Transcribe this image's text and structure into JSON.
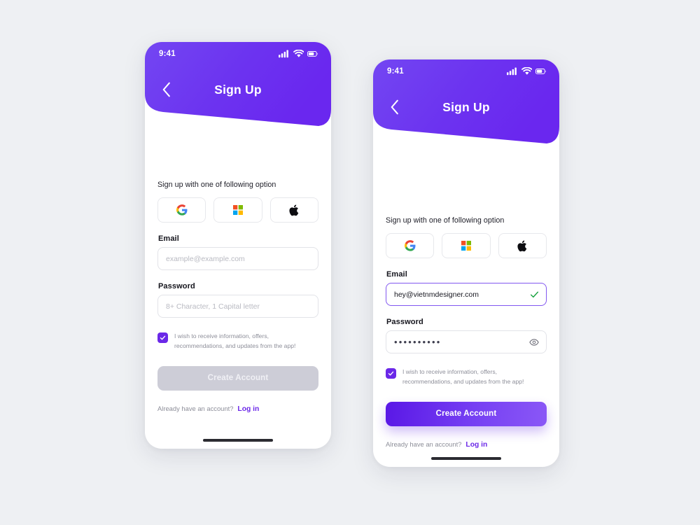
{
  "meta": {
    "background_color": "#eef0f3",
    "brand_purple": "#6b28e8",
    "brand_purple_light": "#8a57f6"
  },
  "status_bar": {
    "time": "9:41",
    "signal_icon": "cellular-signal-icon",
    "wifi_icon": "wifi-icon",
    "battery_icon": "battery-icon"
  },
  "header": {
    "title": "Sign Up",
    "back_icon": "chevron-left-icon"
  },
  "form": {
    "social_prompt": "Sign up with one of following option",
    "social_buttons": [
      {
        "name": "google",
        "icon": "google-icon"
      },
      {
        "name": "microsoft",
        "icon": "microsoft-icon"
      },
      {
        "name": "apple",
        "icon": "apple-icon"
      }
    ],
    "email_label": "Email",
    "password_label": "Password",
    "consent_text": "I wish to receive information, offers, recommendations, and updates from the app!",
    "footer_text": "Already have an account?",
    "footer_link": "Log in"
  },
  "screen_empty": {
    "email_value": "",
    "email_placeholder": "example@example.com",
    "password_value": "",
    "password_placeholder": "8+ Character, 1 Capital letter",
    "cta_label": "Create Account",
    "cta_state": "disabled"
  },
  "screen_filled": {
    "email_value": "hey@vietnmdesigner.com",
    "email_placeholder": "example@example.com",
    "password_masked": "••••••••••",
    "password_char_count": 10,
    "valid_icon": "check-mark-icon",
    "reveal_icon": "eye-icon",
    "cta_label": "Create Account",
    "cta_state": "active"
  }
}
